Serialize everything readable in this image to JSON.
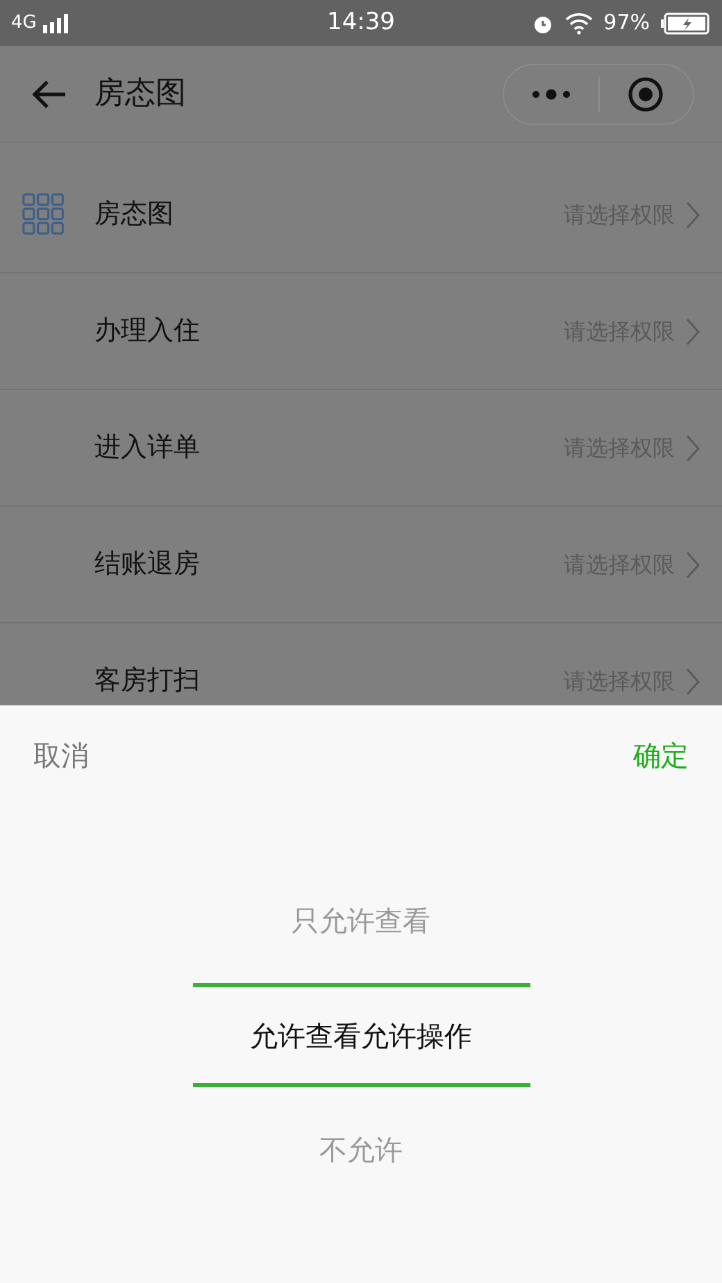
{
  "status_bar": {
    "network": "4G",
    "time": "14:39",
    "battery": "97%"
  },
  "nav": {
    "title": "房态图"
  },
  "rows": [
    {
      "kind": "icon",
      "label": "房态图",
      "value": "请选择权限"
    },
    {
      "kind": "plain",
      "label": "办理入住",
      "value": "请选择权限"
    },
    {
      "kind": "plain",
      "label": "进入详单",
      "value": "请选择权限"
    },
    {
      "kind": "plain",
      "label": "结账退房",
      "value": "请选择权限"
    },
    {
      "kind": "plain",
      "label": "客房打扫",
      "value": "请选择权限"
    }
  ],
  "sheet": {
    "cancel": "取消",
    "confirm": "确定",
    "options": [
      {
        "label": "只允许查看",
        "selected": false
      },
      {
        "label": "允许查看允许操作",
        "selected": true
      },
      {
        "label": "不允许",
        "selected": false
      }
    ]
  }
}
